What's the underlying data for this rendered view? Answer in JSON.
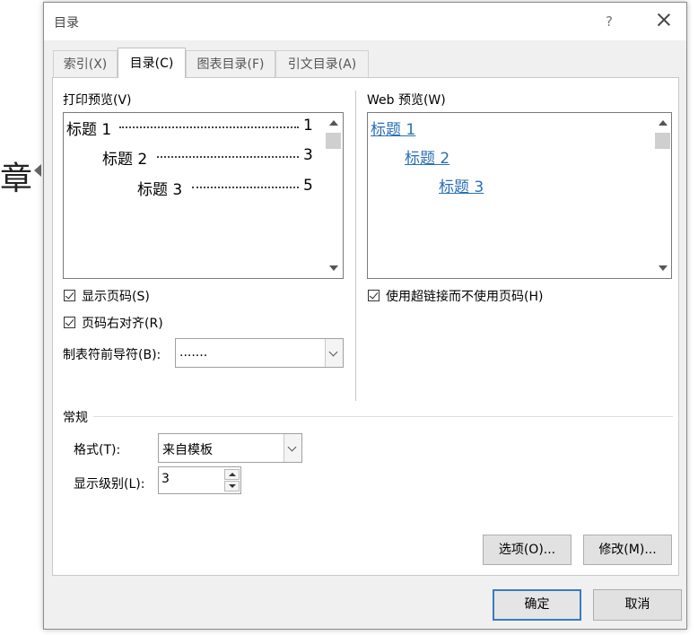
{
  "background": {
    "char": "章"
  },
  "dialog": {
    "title": "目录",
    "help_glyph": "?",
    "tabs": [
      {
        "label": "索引(X)"
      },
      {
        "label": "目录(C)",
        "active": true
      },
      {
        "label": "图表目录(F)"
      },
      {
        "label": "引文目录(A)"
      }
    ]
  },
  "print_preview": {
    "label": "打印预览(V)",
    "entries": [
      {
        "text": "标题  1",
        "page": "1"
      },
      {
        "text": "标题  2",
        "page": "3"
      },
      {
        "text": "标题  3",
        "page": "5"
      }
    ]
  },
  "web_preview": {
    "label": "Web 预览(W)",
    "entries": [
      {
        "text": "标题  1"
      },
      {
        "text": "标题  2"
      },
      {
        "text": "标题  3"
      }
    ]
  },
  "options": {
    "show_page_numbers": {
      "label": "显示页码(S)",
      "checked": true
    },
    "right_align": {
      "label": "页码右对齐(R)",
      "checked": true
    },
    "use_hyperlinks": {
      "label": "使用超链接而不使用页码(H)",
      "checked": true
    },
    "tab_leader": {
      "label": "制表符前导符(B):",
      "value": "......."
    }
  },
  "general": {
    "label": "常规",
    "format": {
      "label": "格式(T):",
      "value": "来自模板"
    },
    "levels": {
      "label": "显示级别(L):",
      "value": "3"
    }
  },
  "buttons": {
    "options": "选项(O)...",
    "modify": "修改(M)...",
    "ok": "确定",
    "cancel": "取消"
  },
  "colors": {
    "link": "#2a6fb5",
    "default_button_border": "#3b7ac2",
    "dialog_bg": "#f0f0f0"
  }
}
